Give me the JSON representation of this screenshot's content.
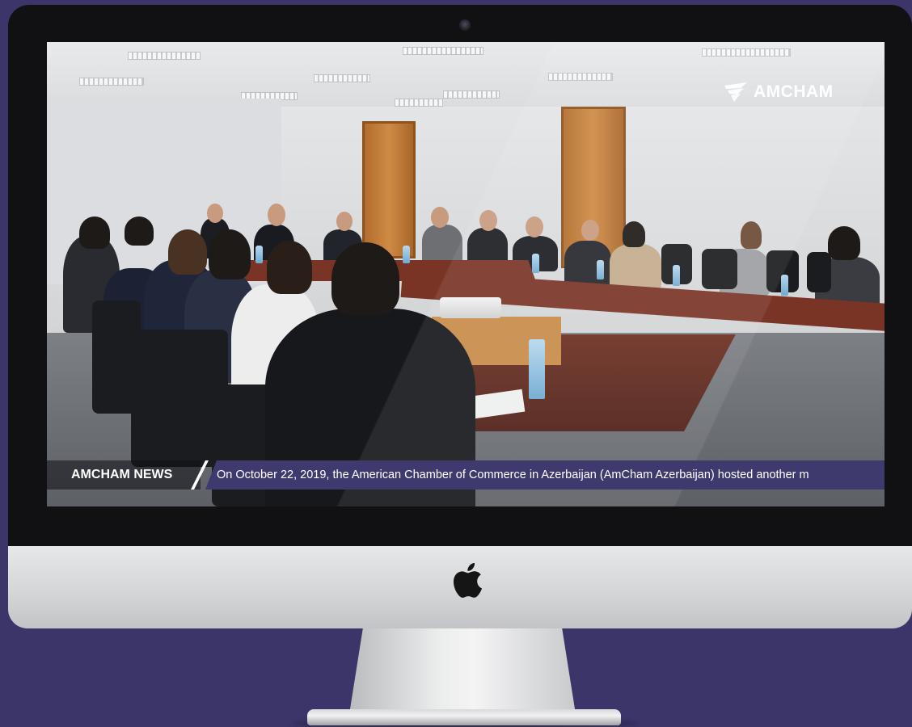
{
  "screen": {
    "brand_name": "AMCHAM",
    "brand_icon": "amcham-wing-icon",
    "news_label": "AMCHAM NEWS",
    "news_text": "On October 22, 2019, the American Chamber of Commerce in Azerbaijan (AmCham Azerbaijan) hosted another m"
  },
  "device": {
    "logo_icon": "apple-icon"
  },
  "colors": {
    "background": "#3b3569",
    "ticker_bar": "#3e3a6d",
    "bezel": "#111114",
    "chin": "#d5d6d8"
  }
}
